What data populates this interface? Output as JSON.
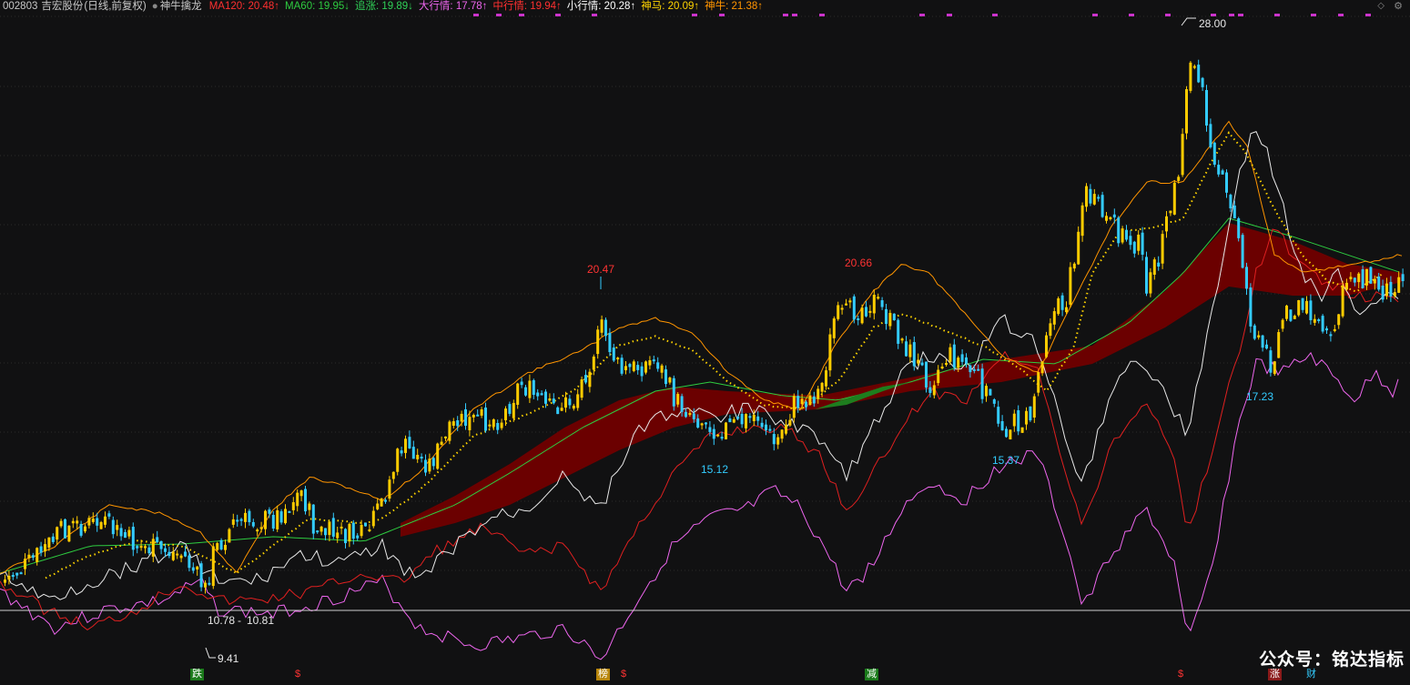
{
  "header": {
    "stock_code": "002803",
    "stock_name": "吉宏股份",
    "period": "(日线,前复权)",
    "indicator_name": "神牛擒龙",
    "ma120": "MA120: 20.48↑",
    "ma60": "MA60: 19.95↓",
    "zhuizhang": "追涨: 19.89↓",
    "da_hangqing": "大行情: 17.78↑",
    "zhong_hangqing": "中行情: 19.94↑",
    "xiao_hangqing": "小行情: 20.28↑",
    "shenma": "神马: 20.09↑",
    "shenniu": "神牛: 21.38↑"
  },
  "colors": {
    "background": "#111112",
    "ma120": "#ff3030",
    "ma60": "#2ecc40",
    "zhuizhang": "#30d158",
    "da_hangqing": "#ee66ee",
    "zhong_hangqing": "#ff3030",
    "xiao_hangqing": "#ffffff",
    "shenma": "#ffd400",
    "shenniu": "#ff9500",
    "up_candle": "#ffcc00",
    "down_candle": "#33ccff",
    "band_fill": "#6b0000"
  },
  "chart_data": {
    "type": "candlestick",
    "price_labels": {
      "high_1": "20.47",
      "high_2": "20.66",
      "high_3": "28.00",
      "low_1": "15.12",
      "low_2": "15.37",
      "low_3": "17.23",
      "low_4": "9.41",
      "low_5a": "10.78",
      "low_5b": "10.81"
    }
  },
  "bottom_markers": {
    "die": "跌",
    "dollar_1": "$",
    "bang": "榜",
    "dollar_2": "$",
    "jian": "减",
    "dollar_3": "$",
    "zhang": "涨",
    "cai": "财"
  },
  "icons": {
    "top_right_1": "diamond-icon",
    "top_right_2": "settings-icon"
  },
  "watermark": "公众号：铭达指标"
}
